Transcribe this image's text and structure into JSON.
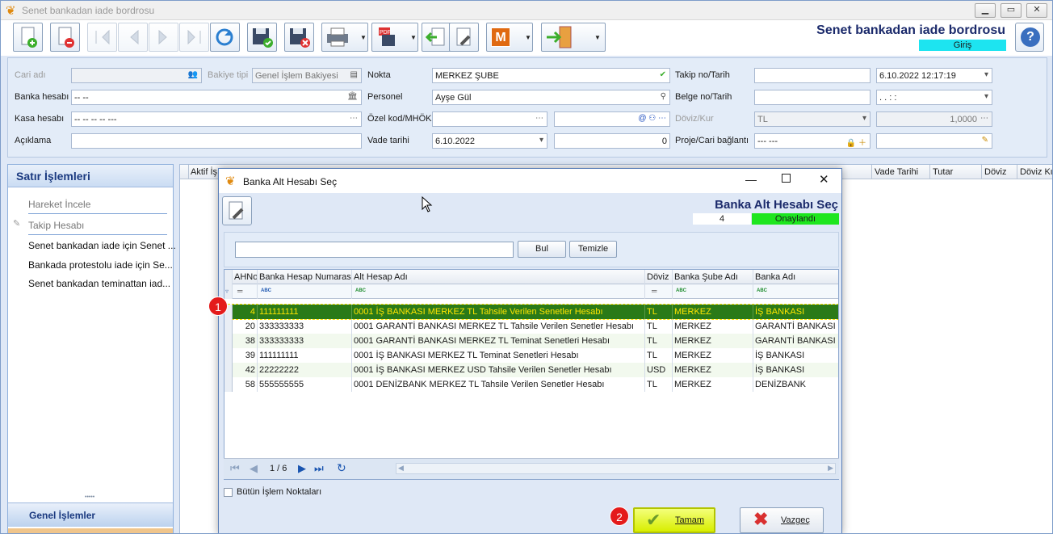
{
  "window": {
    "title": "Senet bankadan iade bordrosu",
    "min": "▁",
    "max": "▭",
    "close": "✕"
  },
  "header": {
    "form_title": "Senet bankadan iade bordrosu",
    "status": "Giriş",
    "help": "?"
  },
  "form": {
    "cari_adi_label": "Cari adı",
    "bakiye_tipi_label": "Bakiye tipi",
    "bakiye_tipi_value": "Genel İşlem Bakiyesi",
    "nokta_label": "Nokta",
    "nokta_value": "MERKEZ ŞUBE",
    "takip_label": "Takip no/Tarih",
    "takip_date": "6.10.2022 12:17:19",
    "banka_label": "Banka hesabı",
    "banka_value": "-- --",
    "personel_label": "Personel",
    "personel_value": "Ayşe Gül",
    "belge_label": "Belge no/Tarih",
    "belge_date": ". .   : :",
    "kasa_label": "Kasa hesabı",
    "kasa_value": "-- -- -- -- ---",
    "ozel_label": "Özel kod/MHÖK",
    "doviz_label": "Döviz/Kur",
    "doviz_value": "TL",
    "kur_value": "1,0000",
    "aciklama_label": "Açıklama",
    "vade_label": "Vade tarihi",
    "vade_value": "6.10.2022",
    "vade_num": "0",
    "proje_label": "Proje/Cari bağlantı",
    "proje_value": "--- ---"
  },
  "left_panel": {
    "title": "Satır İşlemleri",
    "items": [
      "Hareket İncele",
      "Takip Hesabı",
      "Senet bankadan iade için Senet ...",
      "Bankada protestolu iade için Se...",
      "Senet bankadan teminattan iad..."
    ],
    "grip": "•••••",
    "footer": "Genel İşlemler"
  },
  "main_grid": {
    "columns": [
      "Aktif İş",
      "i",
      "Vade Tarihi",
      "Tutar",
      "Döviz",
      "Döviz Ku"
    ]
  },
  "dialog": {
    "title": "Banka Alt Hesabı Seç",
    "heading": "Banka Alt Hesabı Seç",
    "count": "4",
    "status": "Onaylandı",
    "search_value": "",
    "bul": "Bul",
    "temizle": "Temizle",
    "columns": [
      "AHNo",
      "Banka Hesap Numarası",
      "Alt Hesap Adı",
      "Döviz",
      "Banka Şube Adı",
      "Banka Adı"
    ],
    "filter_eq": "═",
    "filter_abc": "ABC",
    "rows": [
      [
        "4",
        "111111111",
        "0001 İŞ BANKASI MERKEZ TL Tahsile Verilen Senetler Hesabı",
        "TL",
        "MERKEZ",
        "İŞ BANKASI"
      ],
      [
        "20",
        "333333333",
        "0001 GARANTİ BANKASI MERKEZ TL Tahsile Verilen Senetler Hesabı",
        "TL",
        "MERKEZ",
        "GARANTİ BANKASI"
      ],
      [
        "38",
        "333333333",
        "0001 GARANTİ BANKASI MERKEZ TL Teminat Senetleri Hesabı",
        "TL",
        "MERKEZ",
        "GARANTİ BANKASI"
      ],
      [
        "39",
        "111111111",
        "0001 İŞ BANKASI MERKEZ TL Teminat Senetleri Hesabı",
        "TL",
        "MERKEZ",
        "İŞ BANKASI"
      ],
      [
        "42",
        "22222222",
        "0001 İŞ BANKASI MERKEZ USD Tahsile Verilen Senetler Hesabı",
        "USD",
        "MERKEZ",
        "İŞ BANKASI"
      ],
      [
        "58",
        "555555555",
        "0001 DENİZBANK MERKEZ TL Tahsile Verilen Senetler Hesabı",
        "TL",
        "MERKEZ",
        "DENİZBANK"
      ]
    ],
    "page_info": "1 / 6",
    "all_points_label": "Bütün İşlem Noktaları",
    "ok": "Tamam",
    "cancel": "Vazgeç"
  },
  "annotations": [
    "1",
    "2"
  ],
  "colors": {
    "selected_row": "#2a7a18",
    "selected_text": "#ffe400",
    "ok_button": "#e1f20a",
    "status_ok": "#1ee61e",
    "status_giris": "#1de4f0",
    "badge": "#e41b1b"
  }
}
